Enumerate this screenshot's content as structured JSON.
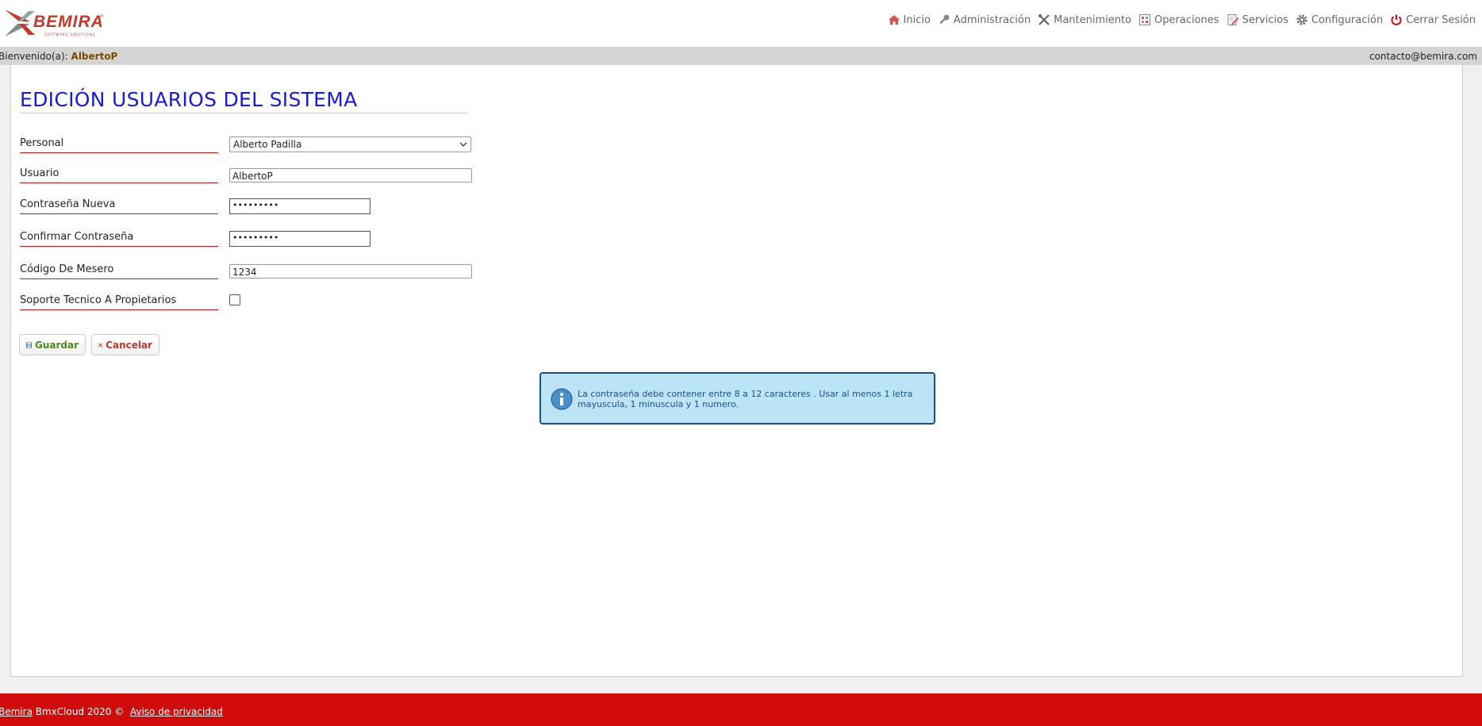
{
  "brand": {
    "name": "BEMIRA",
    "tagline": "SOFTWARE SOLUTIONS",
    "reg": "®",
    "primary_color": "#c0392b"
  },
  "nav": [
    {
      "label": "Inicio",
      "icon": "home-icon"
    },
    {
      "label": "Administración",
      "icon": "key-icon"
    },
    {
      "label": "Mantenimiento",
      "icon": "tools-icon"
    },
    {
      "label": "Operaciones",
      "icon": "grid-icon"
    },
    {
      "label": "Servicios",
      "icon": "document-edit-icon"
    },
    {
      "label": "Configuración",
      "icon": "gear-icon"
    },
    {
      "label": "Cerrar Sesión",
      "icon": "power-icon"
    }
  ],
  "welcome": {
    "prefix": "Bienvenido(a):",
    "user": "AlbertoP",
    "contact": "contacto@bemira.com"
  },
  "page": {
    "title": "EDICIÓN USUARIOS DEL SISTEMA"
  },
  "form": {
    "personal": {
      "label": "Personal",
      "value": "Alberto Padilla"
    },
    "usuario": {
      "label": "Usuario",
      "value": "AlbertoP"
    },
    "password_new": {
      "label": "Contraseña Nueva",
      "value": "•••••••••"
    },
    "password_confirm": {
      "label": "Confirmar Contraseña",
      "value": "•••••••••"
    },
    "codigo": {
      "label": "Código De Mesero",
      "value": "1234"
    },
    "soporte": {
      "label": "Soporte Tecnico A Propietarios",
      "checked": false
    }
  },
  "buttons": {
    "save": "Guardar",
    "cancel": "Cancelar"
  },
  "info": {
    "message": "La contraseña debe contener entre 8 a 12 caracteres . Usar al menos 1 letra mayuscula, 1 minuscula y 1 numero."
  },
  "footer": {
    "brand_link": "Bemira",
    "text": " BmxCloud 2020 ©  ",
    "privacy_link": "Aviso de privacidad"
  },
  "colors": {
    "title": "#1a1ad6",
    "footer_bg": "#d10a0a",
    "label_underline": "#dd1111",
    "info_bg": "#bde3f6",
    "info_border": "#1b4f86"
  }
}
